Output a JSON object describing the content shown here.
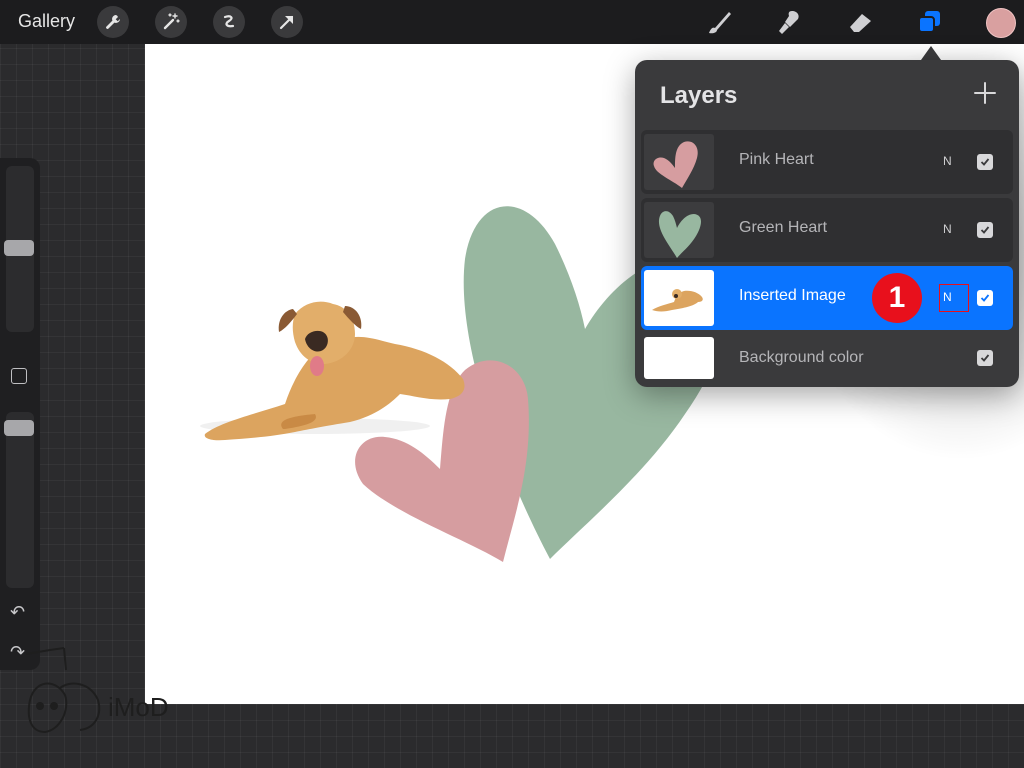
{
  "topbar": {
    "gallery_label": "Gallery",
    "left_tools": [
      "wrench-icon",
      "magic-wand-icon",
      "selection-icon",
      "transform-arrow-icon"
    ],
    "right_tools": [
      "brush-icon",
      "smudge-icon",
      "eraser-icon",
      "layers-icon"
    ],
    "current_color": "#d9a0a0",
    "accent": "#0a74ff"
  },
  "layers": {
    "title": "Layers",
    "items": [
      {
        "name": "Pink Heart",
        "blend": "N",
        "visible": true,
        "selected": false
      },
      {
        "name": "Green Heart",
        "blend": "N",
        "visible": true,
        "selected": false
      },
      {
        "name": "Inserted Image",
        "blend": "N",
        "visible": true,
        "selected": true
      },
      {
        "name": "Background color",
        "blend": "",
        "visible": true,
        "selected": false
      }
    ]
  },
  "annotation": {
    "step": "1",
    "color": "#e8101c"
  },
  "watermark": {
    "text": "iMoD"
  }
}
